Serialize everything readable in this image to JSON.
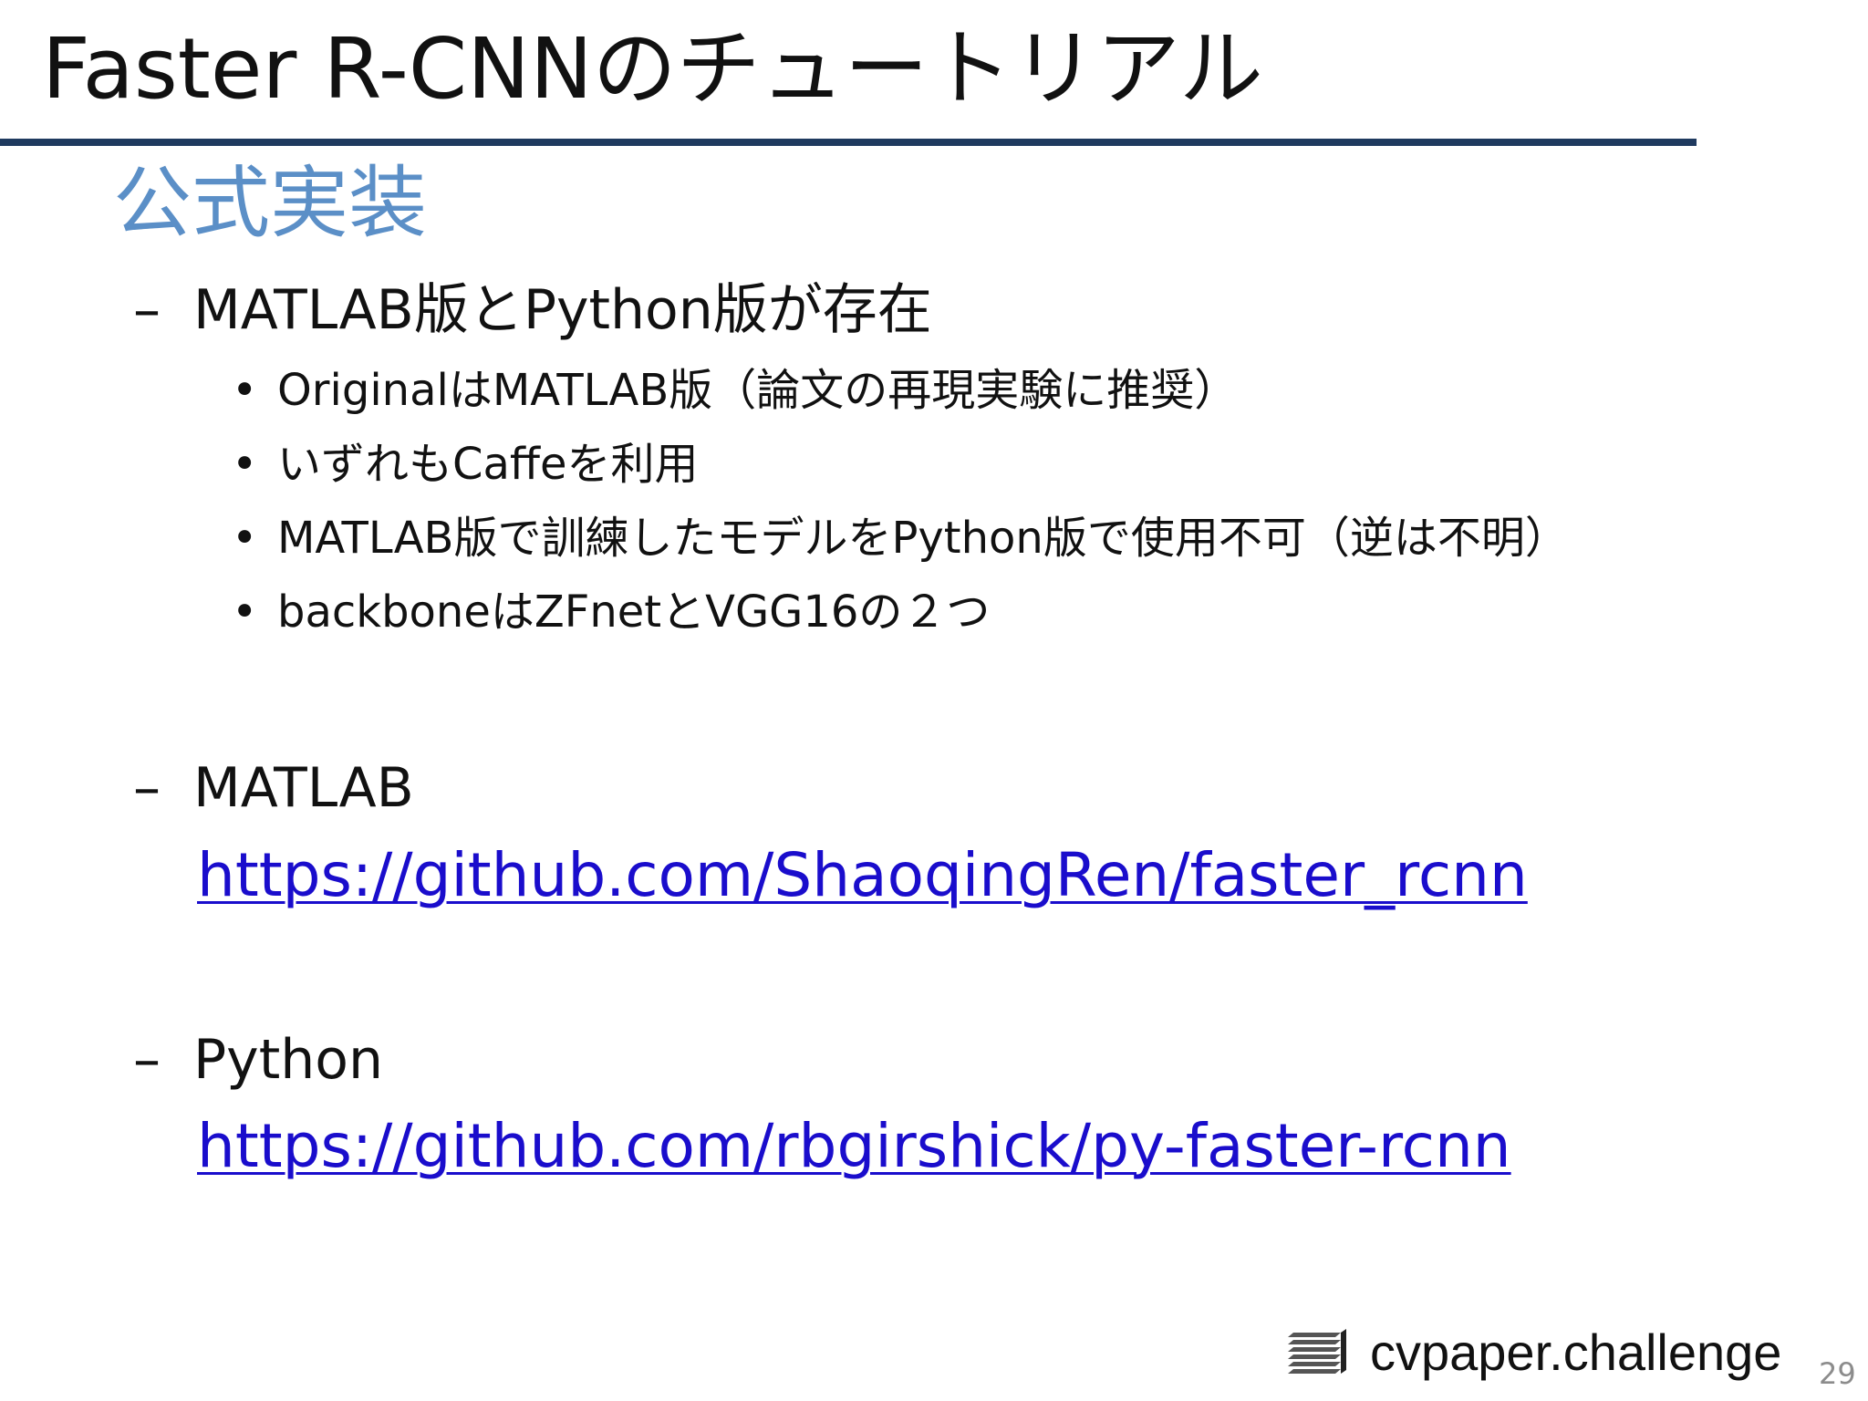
{
  "slide": {
    "title": "Faster R-CNNのチュートリアル",
    "section_heading": "公式実装",
    "items": [
      {
        "dash": "–",
        "text": "MATLAB版とPython版が存在",
        "bullets": [
          "OriginalはMATLAB版（論文の再現実験に推奨）",
          "いずれもCaffeを利用",
          "MATLAB版で訓練したモデルをPython版で使用不可（逆は不明）",
          "backboneはZFnetとVGG16の２つ"
        ]
      },
      {
        "dash": "–",
        "text": "MATLAB",
        "link": "https://github.com/ShaoqingRen/faster_rcnn"
      },
      {
        "dash": "–",
        "text": "Python",
        "link": "https://github.com/rbgirshick/py-faster-rcnn"
      }
    ],
    "bullet_glyph": "•",
    "footer": {
      "logo_text": "cvpaper.challenge",
      "logo_icon": "stacked-layers-icon",
      "page_number": "29"
    }
  },
  "colors": {
    "title_rule": "#1f3a5f",
    "section_heading": "#5b8fc7",
    "link": "#1a0dcc",
    "page_number": "#8c8c8c"
  }
}
